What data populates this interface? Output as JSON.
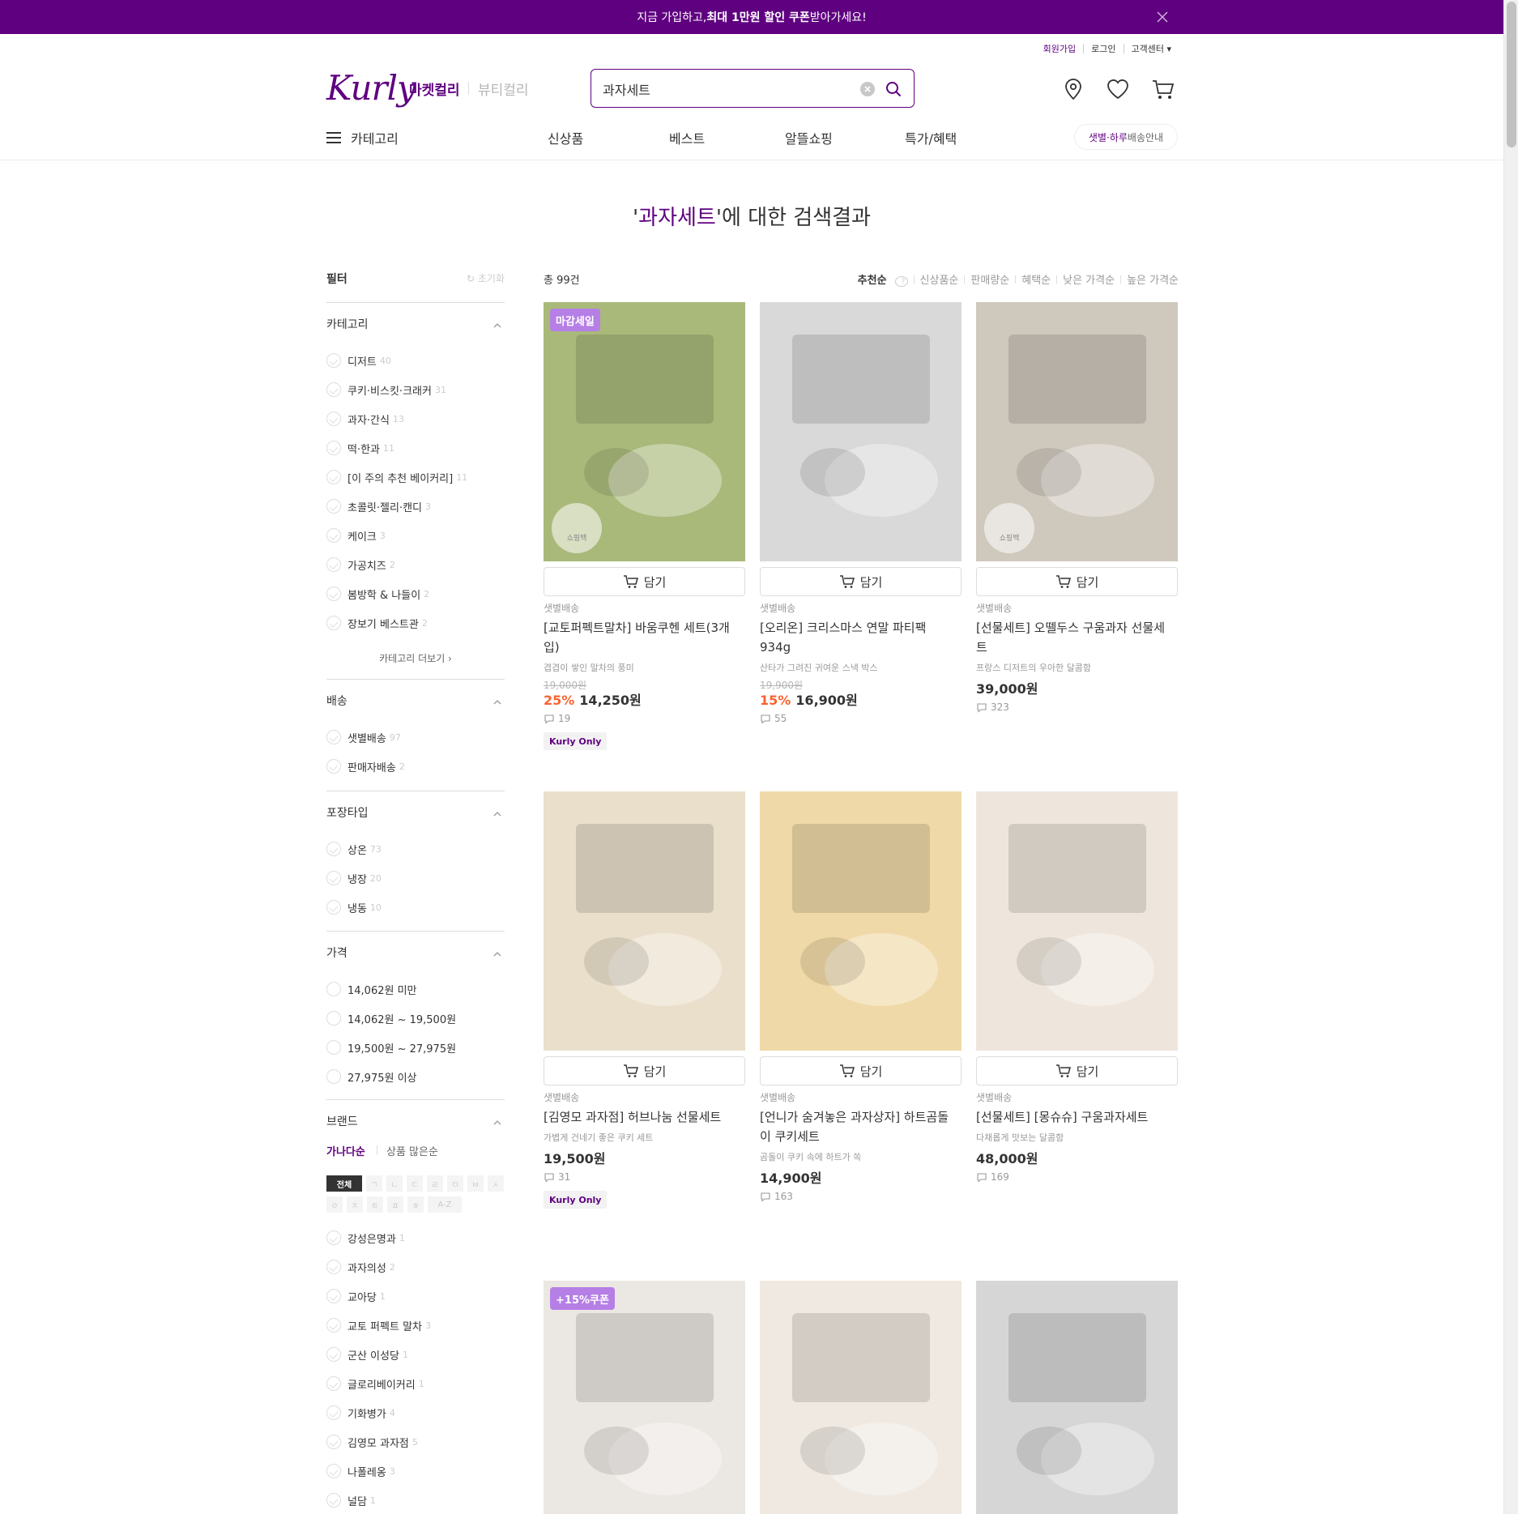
{
  "banner": {
    "pre": "지금 가입하고, ",
    "bold": "최대 1만원 할인 쿠폰",
    "post": " 받아가세요!"
  },
  "top_links": {
    "join": "회원가입",
    "login": "로그인",
    "cs": "고객센터 ▾"
  },
  "header": {
    "logo": "Kurly",
    "market": "마켓컬리",
    "beauty": "뷰티컬리",
    "search_value": "과자세트"
  },
  "nav": {
    "category": "카테고리",
    "items": [
      "신상품",
      "베스트",
      "알뜰쇼핑",
      "특가/혜택"
    ],
    "delivery_a": "샛별·하루",
    "delivery_b": " 배송안내"
  },
  "result_title": {
    "q": "과자세트",
    "rest": "'에 대한 검색결과"
  },
  "filter": {
    "title": "필터",
    "reset": "초기화",
    "category": {
      "title": "카테고리",
      "more": "카테고리 더보기 ›",
      "options": [
        {
          "label": "디저트",
          "count": "40"
        },
        {
          "label": "쿠키·비스킷·크래커",
          "count": "31"
        },
        {
          "label": "과자·간식",
          "count": "13"
        },
        {
          "label": "떡·한과",
          "count": "11"
        },
        {
          "label": "[이 주의 추천 베이커리]",
          "count": "11"
        },
        {
          "label": "초콜릿·젤리·캔디",
          "count": "3"
        },
        {
          "label": "케이크",
          "count": "3"
        },
        {
          "label": "가공치즈",
          "count": "2"
        },
        {
          "label": "봄방학 & 나들이",
          "count": "2"
        },
        {
          "label": "장보기 베스트관",
          "count": "2"
        }
      ]
    },
    "delivery": {
      "title": "배송",
      "options": [
        {
          "label": "샛별배송",
          "count": "97"
        },
        {
          "label": "판매자배송",
          "count": "2"
        }
      ]
    },
    "packaging": {
      "title": "포장타입",
      "options": [
        {
          "label": "상온",
          "count": "73"
        },
        {
          "label": "냉장",
          "count": "20"
        },
        {
          "label": "냉동",
          "count": "10"
        }
      ]
    },
    "price": {
      "title": "가격",
      "options": [
        {
          "label": "14,062원 미만"
        },
        {
          "label": "14,062원 ~ 19,500원"
        },
        {
          "label": "19,500원 ~ 27,975원"
        },
        {
          "label": "27,975원 이상"
        }
      ]
    },
    "brand": {
      "title": "브랜드",
      "sort_a": "가나다순",
      "sort_b": "상품 많은순",
      "letters_row1": [
        "전체",
        "ㄱ",
        "ㄴ",
        "ㄷ",
        "ㄹ",
        "ㅁ",
        "ㅂ",
        "ㅅ"
      ],
      "letters_row2": [
        "ㅇ",
        "ㅈ",
        "ㅌ",
        "ㅍ",
        "ㅎ",
        "A-Z"
      ],
      "options": [
        {
          "label": "강성은명과",
          "count": "1"
        },
        {
          "label": "과자의성",
          "count": "2"
        },
        {
          "label": "교아당",
          "count": "1"
        },
        {
          "label": "교토 퍼펙트 말차",
          "count": "3"
        },
        {
          "label": "군산 이성당",
          "count": "1"
        },
        {
          "label": "글로리베이커리",
          "count": "1"
        },
        {
          "label": "기화병가",
          "count": "4"
        },
        {
          "label": "김영모 과자점",
          "count": "5"
        },
        {
          "label": "나폴레옹",
          "count": "3"
        },
        {
          "label": "널담",
          "count": "1"
        }
      ]
    }
  },
  "results": {
    "total": "총 99건",
    "sorts": [
      "추천순",
      "신상품순",
      "판매량순",
      "혜택순",
      "낮은 가격순",
      "높은 가격순"
    ],
    "cart_label": "담기",
    "products": [
      {
        "badge": "마감세일",
        "bag": "쇼핑백",
        "delivery": "샛별배송",
        "name": "[교토퍼펙트말차] 바움쿠헨 세트(3개입)",
        "desc": "겹겹이 쌓인 말차의 풍미",
        "orig": "19,000원",
        "pct": "25%",
        "price": "14,250원",
        "reviews": "19",
        "kurly_only": "Kurly Only",
        "bg": "#a9b97a"
      },
      {
        "delivery": "샛별배송",
        "name": "[오리온] 크리스마스 연말 파티팩 934g",
        "desc": "산타가 그려진 귀여운 스낵 박스",
        "orig": "19,900원",
        "pct": "15%",
        "price": "16,900원",
        "reviews": "55",
        "bg": "#d9d9d9"
      },
      {
        "bag": "쇼핑백",
        "delivery": "샛별배송",
        "name": "[선물세트] 오뗄두스 구움과자 선물세트",
        "desc": "프랑스 디저트의 우아한 달콤함",
        "price": "39,000원",
        "reviews": "323",
        "bg": "#cfc8bd"
      },
      {
        "delivery": "샛별배송",
        "name": "[김영모 과자점] 허브나눔 선물세트",
        "desc": "가볍게 건네기 좋은 쿠키 세트",
        "price": "19,500원",
        "reviews": "31",
        "kurly_only": "Kurly Only",
        "bg": "#eadfcb"
      },
      {
        "delivery": "샛별배송",
        "name": "[언니가 숨겨놓은 과자상자] 하트곰돌이 쿠키세트",
        "desc": "곰돌이 쿠키 속에 하트가 쏙",
        "price": "14,900원",
        "reviews": "163",
        "bg": "#f0d9a8"
      },
      {
        "delivery": "샛별배송",
        "name": "[선물세트] [몽슈슈] 구움과자세트",
        "desc": "다채롭게 맛보는 달콤함",
        "price": "48,000원",
        "reviews": "169",
        "bg": "#eee6dc"
      },
      {
        "badge": "+15%쿠폰",
        "bg": "#ebe7e2"
      },
      {
        "bg": "#efe9e1"
      },
      {
        "bg": "#d6d6d6"
      }
    ]
  },
  "colors": {
    "brand": "#5f0080",
    "discount": "#fa622f",
    "badge": "#b57fe6"
  }
}
